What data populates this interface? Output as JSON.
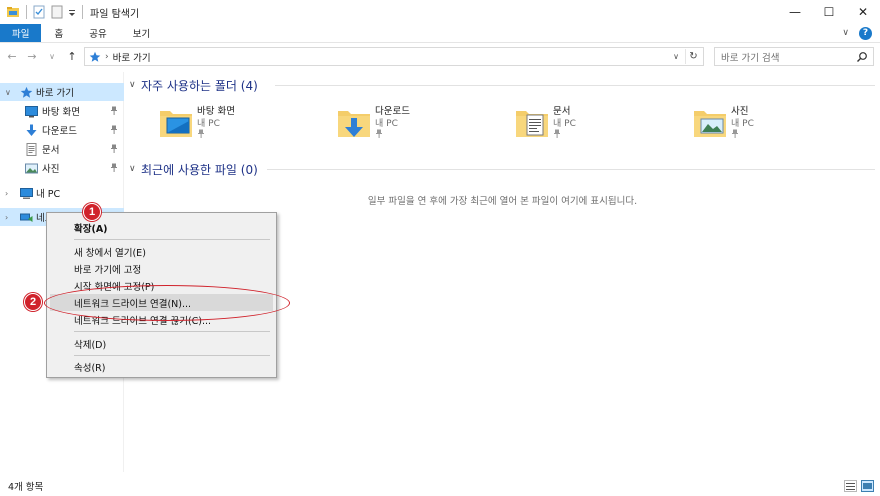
{
  "window": {
    "title": "파일 탐색기",
    "controls": {
      "minimize": "—",
      "maximize": "☐",
      "close": "✕"
    }
  },
  "ribbon": {
    "tabs": [
      "파일",
      "홈",
      "공유",
      "보기"
    ],
    "collapse_glyph": "∨",
    "help": "?"
  },
  "navigation": {
    "back": "←",
    "forward": "→",
    "recent": "∨",
    "up": "↑",
    "address_chevron": "›",
    "address_path": "바로 가기",
    "dropdown": "∨",
    "refresh": "↻",
    "search_placeholder": "바로 가기 검색"
  },
  "nav_pane": {
    "quick_access": "바로 가기",
    "pinned": [
      {
        "label": "바탕 화면",
        "icon": "desktop-icon"
      },
      {
        "label": "다운로드",
        "icon": "download-icon"
      },
      {
        "label": "문서",
        "icon": "documents-icon"
      },
      {
        "label": "사진",
        "icon": "pictures-icon"
      }
    ],
    "this_pc": "내 PC",
    "network": "네트워크",
    "expand_glyph": "›",
    "expanded_glyph": "∨",
    "pin_glyph": "📌"
  },
  "main": {
    "frequent_header": "자주 사용하는 폴더 (4)",
    "recent_header": "최근에 사용한 파일 (0)",
    "folders": [
      {
        "name": "바탕 화면",
        "location": "내 PC",
        "icon": "desktop-folder-icon"
      },
      {
        "name": "다운로드",
        "location": "내 PC",
        "icon": "download-folder-icon"
      },
      {
        "name": "문서",
        "location": "내 PC",
        "icon": "documents-folder-icon"
      },
      {
        "name": "사진",
        "location": "내 PC",
        "icon": "pictures-folder-icon"
      }
    ],
    "empty_message": "일부 파일을 연 후에 가장 최근에 열어 본 파일이 여기에 표시됩니다."
  },
  "context_menu": {
    "items": [
      "확장(A)",
      "새 창에서 열기(E)",
      "바로 가기에 고정",
      "시작 화면에 고정(P)",
      "네트워크 드라이브 연결(N)...",
      "네트워크 드라이브 연결 끊기(C)...",
      "삭제(D)",
      "속성(R)"
    ],
    "highlighted_index": 4
  },
  "annotations": {
    "badge1": "1",
    "badge2": "2"
  },
  "status_bar": {
    "item_count": "4개 항목"
  },
  "colors": {
    "accent": "#1979ca",
    "annotation": "#d0222b",
    "selection": "#cce8ff"
  }
}
